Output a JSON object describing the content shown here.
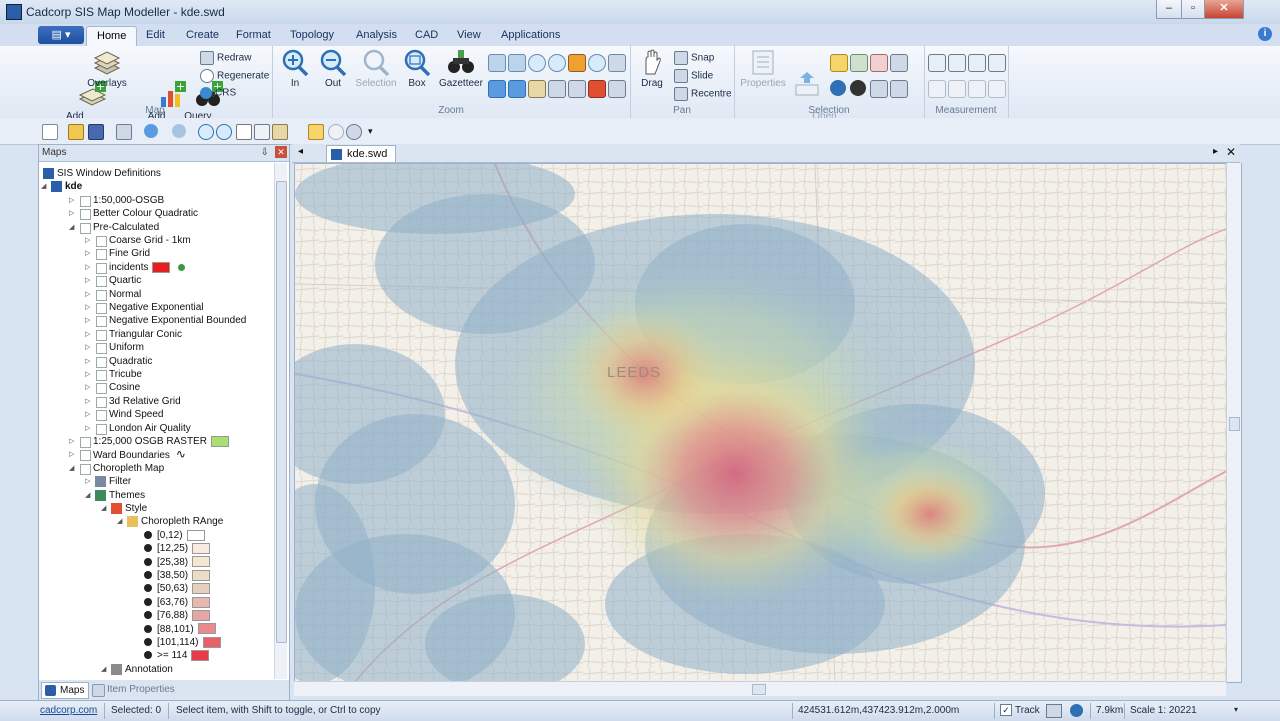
{
  "window": {
    "title": "Cadcorp SIS Map Modeller - kde.swd"
  },
  "ribbon": {
    "file_label": "▤ ▾",
    "tabs": [
      "Home",
      "Edit",
      "Create",
      "Format",
      "Topology",
      "Analysis",
      "CAD",
      "View",
      "Applications"
    ],
    "active_tab": "Home",
    "map_group": {
      "label": "Map",
      "add_overlay": "Add\nOverlay",
      "overlays": "Overlays",
      "add_theme": "Add\nTheme",
      "query_builder": "Query\nBuilder",
      "redraw": "Redraw",
      "regenerate": "Regenerate",
      "crs": "CRS"
    },
    "zoom_group": {
      "label": "Zoom",
      "in": "In",
      "out": "Out",
      "selection": "Selection",
      "box": "Box",
      "gazetteer": "Gazetteer"
    },
    "pan_group": {
      "label": "Pan",
      "drag": "Drag",
      "snap": "Snap",
      "slide": "Slide",
      "recentre": "Recentre"
    },
    "selection_group": {
      "label": "Selection",
      "properties": "Properties",
      "open_link": "Open\nLink"
    },
    "measurement_group": {
      "label": "Measurement"
    }
  },
  "panel": {
    "title": "Maps",
    "pin": "⇩",
    "close": "✕",
    "tree": [
      {
        "label": "SIS Window Definitions"
      },
      {
        "label": "kde"
      },
      {
        "label": "1:50,000-OSGB"
      },
      {
        "label": "Better Colour Quadratic"
      },
      {
        "label": "Pre-Calculated"
      },
      {
        "label": "Coarse Grid - 1km"
      },
      {
        "label": "Fine Grid"
      },
      {
        "label": "incidents"
      },
      {
        "label": "Quartic"
      },
      {
        "label": "Normal"
      },
      {
        "label": "Negative Exponential"
      },
      {
        "label": "Negative Exponential Bounded"
      },
      {
        "label": "Triangular Conic"
      },
      {
        "label": "Uniform"
      },
      {
        "label": "Quadratic"
      },
      {
        "label": "Tricube"
      },
      {
        "label": "Cosine"
      },
      {
        "label": "3d Relative Grid"
      },
      {
        "label": "Wind Speed"
      },
      {
        "label": "London Air Quality"
      },
      {
        "label": "1:25,000 OSGB RASTER"
      },
      {
        "label": "Ward Boundaries"
      },
      {
        "label": "Choropleth Map"
      },
      {
        "label": "Filter"
      },
      {
        "label": "Themes"
      },
      {
        "label": "Style"
      },
      {
        "label": "Choropleth RAnge"
      },
      {
        "label": "[0,12)"
      },
      {
        "label": "[12,25)"
      },
      {
        "label": "[25,38)"
      },
      {
        "label": "[38,50)"
      },
      {
        "label": "[50,63)"
      },
      {
        "label": "[63,76)"
      },
      {
        "label": "[76,88)"
      },
      {
        "label": "[88,101)"
      },
      {
        "label": "[101,114)"
      },
      {
        "label": ">= 114"
      },
      {
        "label": "Annotation"
      }
    ],
    "range_colors": [
      "#ffffff",
      "#fbe9e3",
      "#f4e8d2",
      "#eadcc6",
      "#e6cfbf",
      "#e8b8b0",
      "#e6a6a4",
      "#e98a8f",
      "#e8606a",
      "#e83a48"
    ],
    "bottom_tabs": [
      "Maps",
      "Item Properties"
    ]
  },
  "document": {
    "tab_label": "kde.swd",
    "map_label": "LEEDS"
  },
  "status": {
    "link": "cadcorp.com",
    "selected": "Selected: 0",
    "hint": "Select item, with Shift to toggle, or Ctrl to copy",
    "coords": "424531.612m,437423.912m,2.000m",
    "track": "Track",
    "distance": "7.9km",
    "scale": "Scale 1:  20221"
  },
  "colors": {
    "heat_low": "#8fb0c9",
    "heat_mid": "#e8e2a0",
    "heat_high": "#e0707a",
    "title_accent": "#2a5ea8"
  }
}
